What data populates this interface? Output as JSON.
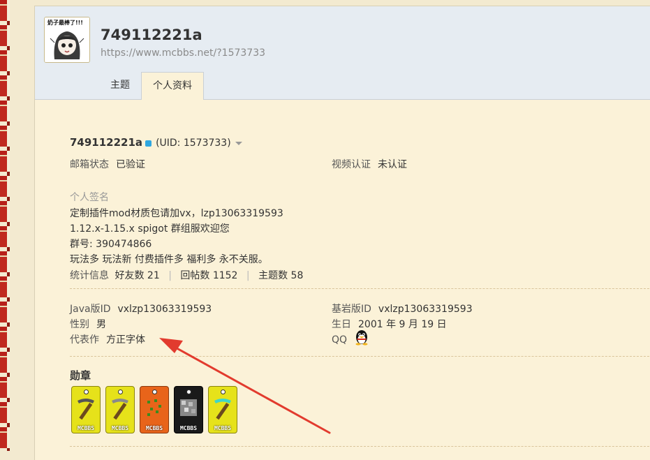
{
  "header": {
    "avatar_caption": "奶子最棒了!!!",
    "username": "749112221a",
    "url": "https://www.mcbbs.net/?1573733",
    "tabs": [
      {
        "label": "主题"
      },
      {
        "label": "个人资料"
      }
    ]
  },
  "profile": {
    "username": "749112221a",
    "uid": "(UID: 1573733)",
    "email_status_label": "邮箱状态",
    "email_status_value": "已验证",
    "video_auth_label": "视频认证",
    "video_auth_value": "未认证",
    "signature_label": "个人签名",
    "signature_lines": [
      "定制插件mod材质包请加vx，lzp13063319593",
      "1.12.x-1.15.x spigot 群组服欢迎您",
      "群号: 390474866",
      "玩法多 玩法新 付费插件多 福利多 永不关服。"
    ],
    "stats_label": "统计信息",
    "stats": [
      {
        "label": "好友数",
        "value": "21"
      },
      {
        "label": "回帖数",
        "value": "1152"
      },
      {
        "label": "主题数",
        "value": "58"
      }
    ]
  },
  "details": {
    "java_label": "Java版ID",
    "java_value": "vxlzp13063319593",
    "bedrock_label": "基岩版ID",
    "bedrock_value": "vxlzp13063319593",
    "gender_label": "性别",
    "gender_value": "男",
    "birthday_label": "生日",
    "birthday_value": "2001 年 9 月 19 日",
    "works_label": "代表作",
    "works_value": "方正字体",
    "qq_label": "QQ"
  },
  "medals": {
    "title": "勋章",
    "items": [
      {
        "label": "MCBBS",
        "color": "#e6e21a",
        "icon": "iron-pickaxe-icon"
      },
      {
        "label": "MCBBS",
        "color": "#e6e21a",
        "icon": "stone-pickaxe-icon"
      },
      {
        "label": "MCBBS",
        "color": "#e8641a",
        "icon": "seeds-icon"
      },
      {
        "label": "MCBBS",
        "color": "#1a1a1a",
        "icon": "ore-block-icon"
      },
      {
        "label": "MCBBS",
        "color": "#e6e21a",
        "icon": "diamond-pickaxe-icon"
      }
    ]
  },
  "colors": {
    "annotation_arrow": "#e23b2e",
    "header_bg": "#e6ecf2",
    "page_bg": "#fbf2d8"
  }
}
